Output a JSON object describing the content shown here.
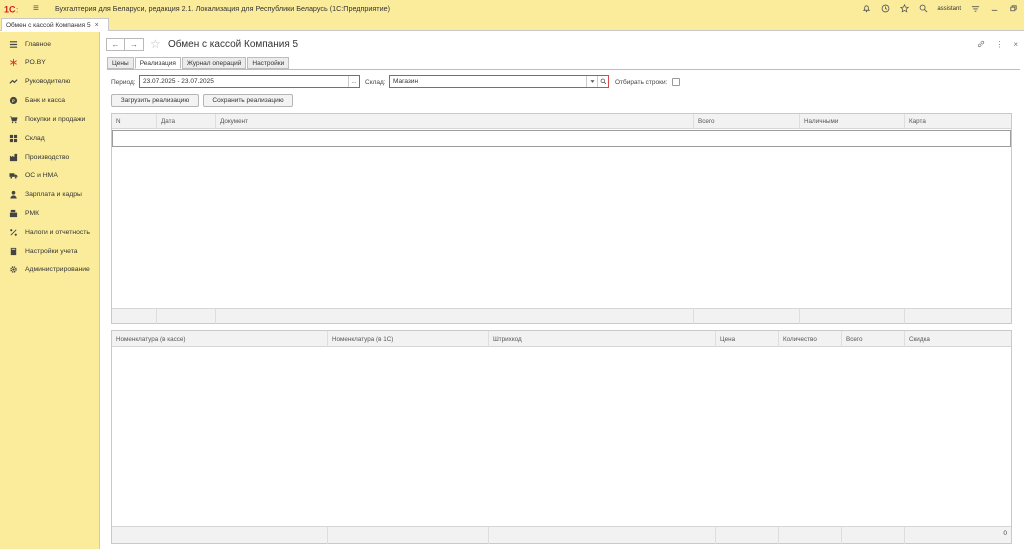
{
  "app": {
    "title": "Бухгалтерия для Беларуси, редакция 2.1. Локализация для Республики Беларусь  (1С:Предприятие)",
    "user": "assistant",
    "colors": {
      "panel": "#fbec9c",
      "accent_border": "#d6474a",
      "logo_red": "#d41e20"
    }
  },
  "open_tab": {
    "label": "Обмен с кассой Компания 5",
    "close": "×"
  },
  "sidebar": {
    "items": [
      {
        "label": "Главное",
        "icon": "menu-lines-icon"
      },
      {
        "label": "PO.BY",
        "icon": "asterisk-icon"
      },
      {
        "label": "Руководителю",
        "icon": "chart-line-icon"
      },
      {
        "label": "Банк и касса",
        "icon": "coin-icon"
      },
      {
        "label": "Покупки и продажи",
        "icon": "cart-icon"
      },
      {
        "label": "Склад",
        "icon": "grid-icon"
      },
      {
        "label": "Производство",
        "icon": "factory-icon"
      },
      {
        "label": "ОС и НМА",
        "icon": "truck-icon"
      },
      {
        "label": "Зарплата и кадры",
        "icon": "person-icon"
      },
      {
        "label": "РМК",
        "icon": "register-icon"
      },
      {
        "label": "Налоги и отчетность",
        "icon": "percent-icon"
      },
      {
        "label": "Настройки учета",
        "icon": "book-icon"
      },
      {
        "label": "Администрирование",
        "icon": "gear-icon"
      }
    ]
  },
  "page": {
    "title": "Обмен с кассой Компания 5",
    "back": "←",
    "forward": "→",
    "tabs": [
      "Цены",
      "Реализация",
      "Журнал операций",
      "Настройки"
    ],
    "active_tab": "Реализация"
  },
  "filters": {
    "period_label": "Период:",
    "period_value": "23.07.2025 - 23.07.2025",
    "period_button": "...",
    "warehouse_label": "Склад:",
    "warehouse_value": "Магазин",
    "select_rows_label": "Отбирать строки:"
  },
  "buttons": {
    "load": "Загрузить реализацию",
    "save": "Сохранить реализацию"
  },
  "table_top": {
    "columns": [
      "N",
      "Дата",
      "Документ",
      "Всего",
      "Наличными",
      "Карта"
    ]
  },
  "table_bottom": {
    "columns": [
      "Номенклатура (в кассе)",
      "Номенклатура (в 1С)",
      "Штрихкод",
      "Цена",
      "Количество",
      "Всего",
      "Скидка"
    ],
    "footer_total": "0"
  }
}
